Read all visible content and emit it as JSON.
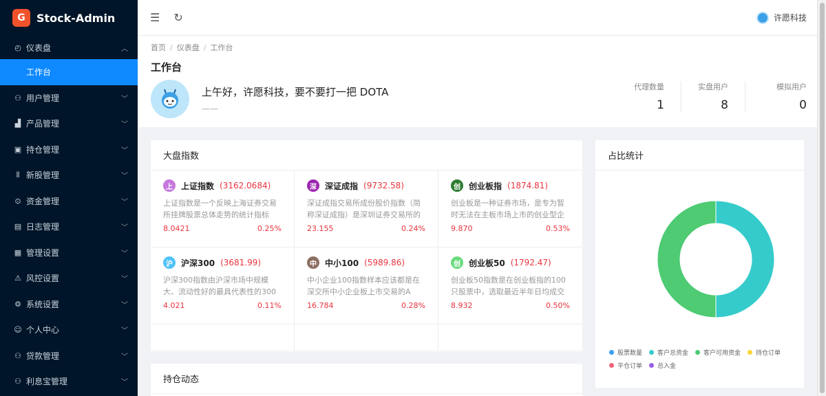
{
  "brand": {
    "logo_text": "G",
    "name": "Stock-Admin"
  },
  "sidebar": {
    "dashboard": {
      "label": "仪表盘",
      "icon": "dashboard-icon"
    },
    "workspace": {
      "label": "工作台"
    },
    "items": [
      {
        "label": "用户管理",
        "icon": "users-icon"
      },
      {
        "label": "产品管理",
        "icon": "chart-icon"
      },
      {
        "label": "持仓管理",
        "icon": "position-icon"
      },
      {
        "label": "新股管理",
        "icon": "ipo-icon"
      },
      {
        "label": "资金管理",
        "icon": "money-icon"
      },
      {
        "label": "日志管理",
        "icon": "log-icon"
      },
      {
        "label": "管理设置",
        "icon": "settings-grid-icon"
      },
      {
        "label": "风控设置",
        "icon": "warning-icon"
      },
      {
        "label": "系统设置",
        "icon": "gear-icon"
      },
      {
        "label": "个人中心",
        "icon": "user-icon"
      },
      {
        "label": "贷款管理",
        "icon": "loan-icon"
      },
      {
        "label": "利息宝管理",
        "icon": "interest-icon"
      }
    ]
  },
  "header": {
    "username": "许愿科技"
  },
  "breadcrumb": [
    "首页",
    "仪表盘",
    "工作台"
  ],
  "page": {
    "title": "工作台",
    "welcome": "上午好，许愿科技，要不要打一把 DOTA",
    "welcome_sub": "——"
  },
  "stats": [
    {
      "label": "代理数量",
      "value": "1"
    },
    {
      "label": "实盘用户",
      "value": "8"
    },
    {
      "label": "模拟用户",
      "value": "0"
    }
  ],
  "index_card": {
    "title": "大盘指数",
    "items": [
      {
        "badge": "上",
        "color": "#c678dd",
        "name": "上证指数",
        "value": "(3162.0684)",
        "desc": "上证指数是一个反映上海证券交易所挂牌股票总体走势的统计指标",
        "amount": "8.0421",
        "percent": "0.25%"
      },
      {
        "badge": "深",
        "color": "#9c27b0",
        "name": "深证成指",
        "value": "(9732.58)",
        "desc": "深证成指交易所成份股价指数（简称深证成指）是深圳证券交易所的",
        "amount": "23.155",
        "percent": "0.24%"
      },
      {
        "badge": "创",
        "color": "#2e7d32",
        "name": "创业板指",
        "value": "(1874.81)",
        "desc": "创业板是一种证券市场，是专为暂时无法在主板市场上市的创业型企",
        "amount": "9.870",
        "percent": "0.53%"
      },
      {
        "badge": "沪",
        "color": "#4fc3f7",
        "name": "沪深300",
        "value": "(3681.99)",
        "desc": "沪深300指数由沪深市场中规模大、流动性好的最具代表性的300只证券",
        "amount": "4.021",
        "percent": "0.11%"
      },
      {
        "badge": "中",
        "color": "#8d6e63",
        "name": "中小100",
        "value": "(5989.86)",
        "desc": "中小企业100指数样本应该都是在深交所中小企业板上市交易的A股。",
        "amount": "16.784",
        "percent": "0.28%"
      },
      {
        "badge": "创",
        "color": "#69db7c",
        "name": "创业板50",
        "value": "(1792.47)",
        "desc": "创业板50指数是在创业板指的100只股票中，选取最近半年日均成交",
        "amount": "8.932",
        "percent": "0.50%"
      }
    ]
  },
  "ratio_card": {
    "title": "占比统计",
    "legend": [
      {
        "label": "股票数量",
        "color": "#3aa0f3"
      },
      {
        "label": "客户总资金",
        "color": "#36cbcb"
      },
      {
        "label": "客户可用资金",
        "color": "#4ecb73"
      },
      {
        "label": "持仓订单",
        "color": "#fbd437"
      },
      {
        "label": "平仓订单",
        "color": "#f2637b"
      },
      {
        "label": "总入金",
        "color": "#975fe5"
      }
    ],
    "segments": [
      {
        "label": "客户总资金",
        "fraction": 0.5,
        "color": "#36cbcb"
      },
      {
        "label": "客户可用资金",
        "fraction": 0.5,
        "color": "#4ecb73"
      }
    ]
  },
  "hold_card": {
    "title": "持仓动态"
  }
}
